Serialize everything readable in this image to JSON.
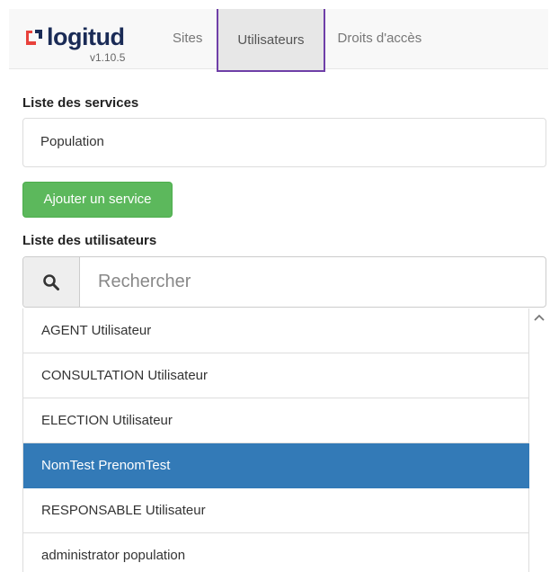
{
  "header": {
    "logo_text": "logitud",
    "version": "v1.10.5",
    "tabs": [
      {
        "label": "Sites",
        "active": false
      },
      {
        "label": "Utilisateurs",
        "active": true
      },
      {
        "label": "Droits d'accès",
        "active": false
      }
    ],
    "active_tab_border_color": "#6f3fa8",
    "logo_colors": {
      "red": "#e8413b",
      "blue": "#1a2b56"
    }
  },
  "services": {
    "title": "Liste des services",
    "items": [
      "Population"
    ],
    "add_button_label": "Ajouter un service",
    "add_button_color": "#5cb85c"
  },
  "users": {
    "title": "Liste des utilisateurs",
    "search": {
      "placeholder": "Rechercher",
      "value": "",
      "icon": "search-icon"
    },
    "items": [
      "AGENT Utilisateur",
      "CONSULTATION Utilisateur",
      "ELECTION Utilisateur",
      "NomTest PrenomTest",
      "RESPONSABLE Utilisateur",
      "administrator population"
    ],
    "selected_index": 3,
    "selected_color": "#337ab7"
  }
}
